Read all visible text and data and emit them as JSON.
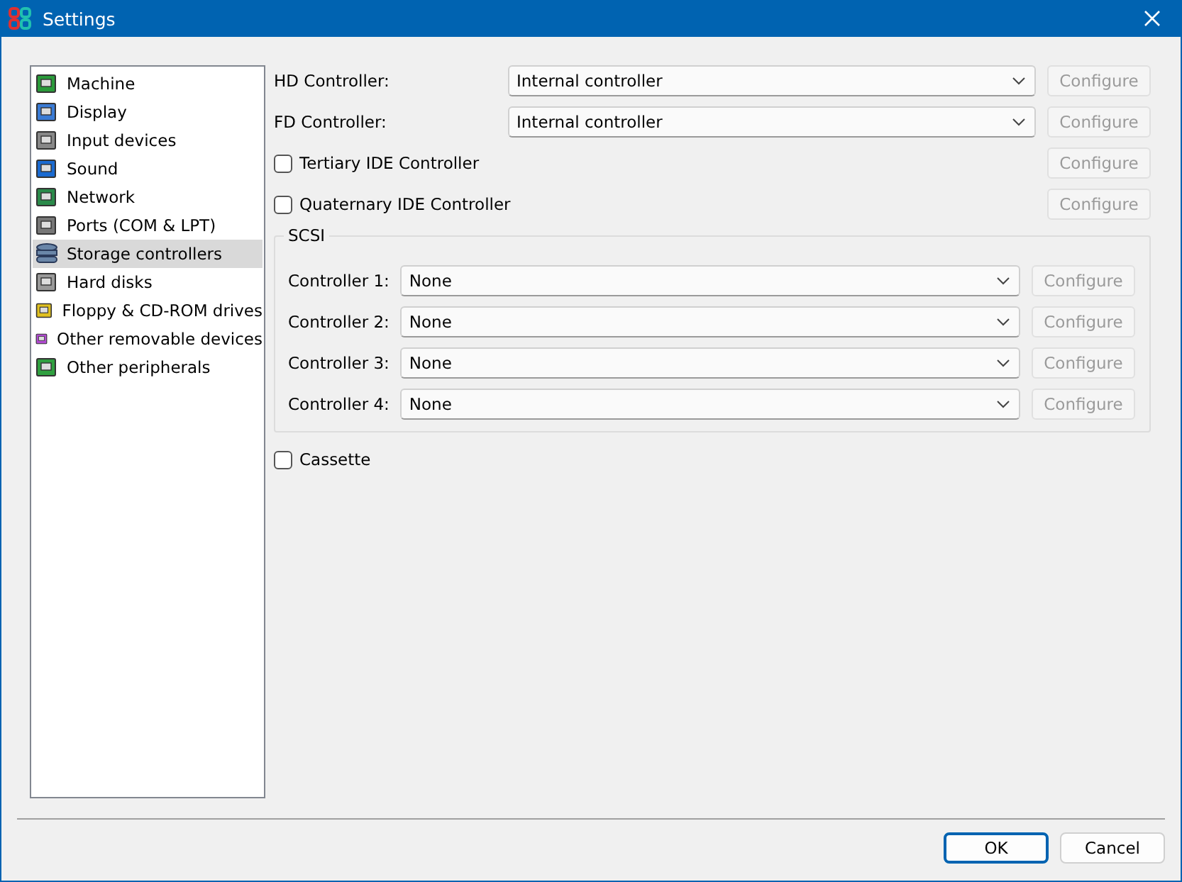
{
  "window": {
    "title": "Settings"
  },
  "sidebar": {
    "items": [
      {
        "label": "Machine",
        "selected": false
      },
      {
        "label": "Display",
        "selected": false
      },
      {
        "label": "Input devices",
        "selected": false
      },
      {
        "label": "Sound",
        "selected": false
      },
      {
        "label": "Network",
        "selected": false
      },
      {
        "label": "Ports (COM & LPT)",
        "selected": false
      },
      {
        "label": "Storage controllers",
        "selected": true
      },
      {
        "label": "Hard disks",
        "selected": false
      },
      {
        "label": "Floppy & CD-ROM drives",
        "selected": false
      },
      {
        "label": "Other removable devices",
        "selected": false
      },
      {
        "label": "Other peripherals",
        "selected": false
      }
    ]
  },
  "controllers": [
    {
      "kind": "dropdown",
      "label": "HD Controller:",
      "value": "Internal controller",
      "configure": {
        "label": "Configure",
        "disabled": true
      }
    },
    {
      "kind": "dropdown",
      "label": "FD Controller:",
      "value": "Internal controller",
      "configure": {
        "label": "Configure",
        "disabled": true
      }
    },
    {
      "kind": "checkbox",
      "label": "Tertiary IDE Controller",
      "checked": false,
      "configure": {
        "label": "Configure",
        "disabled": true
      }
    },
    {
      "kind": "checkbox",
      "label": "Quaternary IDE Controller",
      "checked": false,
      "configure": {
        "label": "Configure",
        "disabled": true
      }
    }
  ],
  "scsi": {
    "title": "SCSI",
    "controllers": [
      {
        "label": "Controller 1:",
        "value": "None",
        "configure": {
          "label": "Configure",
          "disabled": true
        }
      },
      {
        "label": "Controller 2:",
        "value": "None",
        "configure": {
          "label": "Configure",
          "disabled": true
        }
      },
      {
        "label": "Controller 3:",
        "value": "None",
        "configure": {
          "label": "Configure",
          "disabled": true
        }
      },
      {
        "label": "Controller 4:",
        "value": "None",
        "configure": {
          "label": "Configure",
          "disabled": true
        }
      }
    ]
  },
  "cassette": {
    "label": "Cassette",
    "checked": false
  },
  "buttons": [
    {
      "label": "OK",
      "default": true
    },
    {
      "label": "Cancel",
      "default": false
    }
  ]
}
